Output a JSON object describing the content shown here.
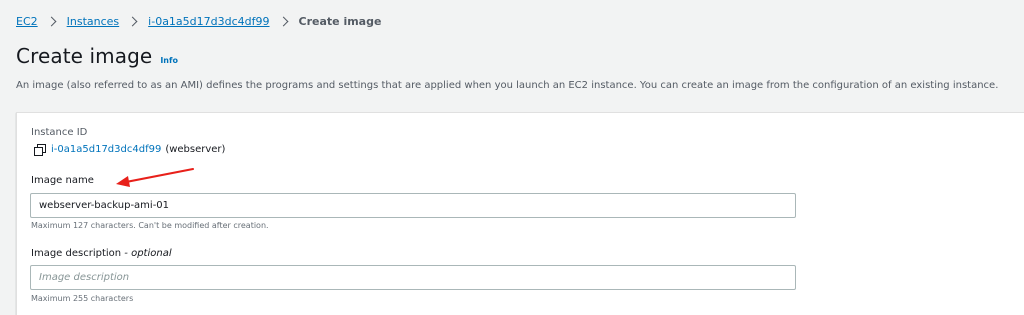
{
  "breadcrumb": {
    "items": [
      {
        "label": "EC2"
      },
      {
        "label": "Instances"
      },
      {
        "label": "i-0a1a5d17d3dc4df99"
      }
    ],
    "current": "Create image"
  },
  "header": {
    "title": "Create image",
    "info_label": "Info",
    "description": "An image (also referred to as an AMI) defines the programs and settings that are applied when you launch an EC2 instance. You can create an image from the configuration of an existing instance."
  },
  "form": {
    "instance_id": {
      "label": "Instance ID",
      "value": "i-0a1a5d17d3dc4df99",
      "suffix": "(webserver)"
    },
    "image_name": {
      "label": "Image name",
      "value": "webserver-backup-ami-01",
      "hint": "Maximum 127 characters. Can't be modified after creation."
    },
    "image_description": {
      "label": "Image description",
      "label_optional": "- optional",
      "placeholder": "Image description",
      "hint": "Maximum 255 characters"
    }
  },
  "annotation": {
    "arrow_color": "#e8201a"
  },
  "colors": {
    "link": "#0073bb",
    "background": "#f2f3f3",
    "panel": "#ffffff"
  }
}
